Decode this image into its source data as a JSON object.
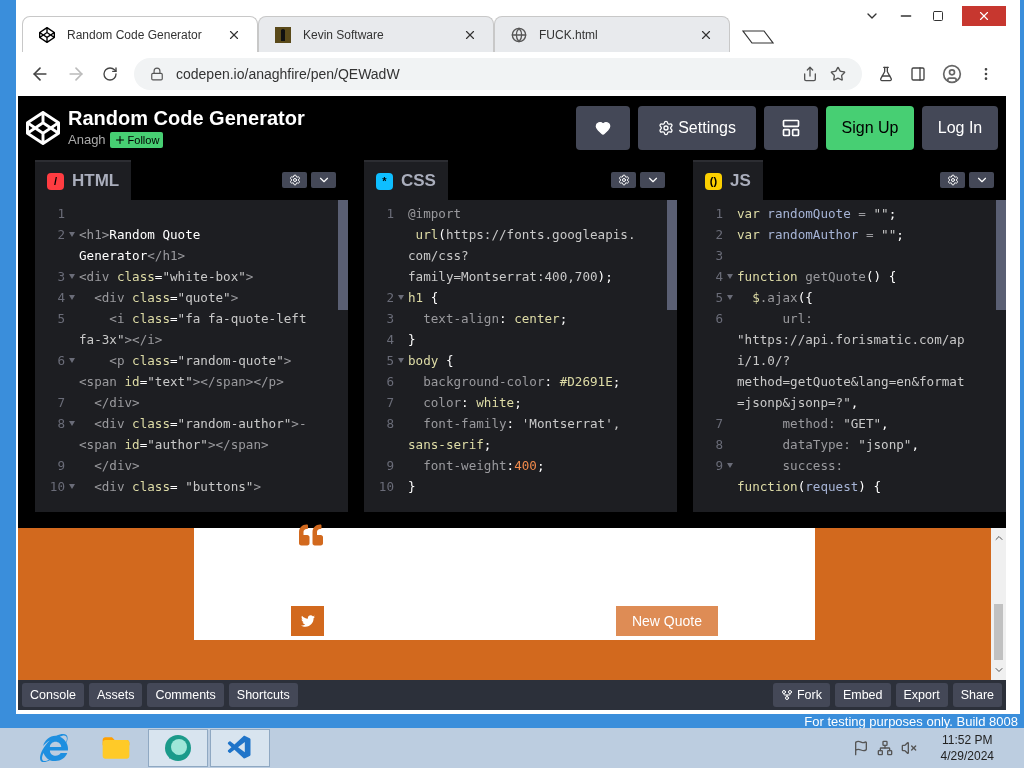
{
  "browser": {
    "tabs": [
      {
        "title": "Random Code Generator",
        "kind": "codepen",
        "selected": true
      },
      {
        "title": "Kevin Software",
        "kind": "thumbnail",
        "selected": false
      },
      {
        "title": "FUCK.html",
        "kind": "globe",
        "selected": false
      }
    ],
    "url": "codepen.io/anaghfire/pen/QEWadW",
    "forward_disabled": true
  },
  "header": {
    "title": "Random Code Generator",
    "author": "Anagh",
    "follow": "Follow",
    "settings": "Settings",
    "sign_up": "Sign Up",
    "log_in": "Log In"
  },
  "editors": [
    {
      "name": "HTML",
      "color": "#ff3c41",
      "symbol": "/",
      "lines": [
        {
          "number": "1",
          "fold": false
        },
        {
          "number": "2",
          "fold": true,
          "tokens": [
            {
              "kind": "tag",
              "text": "<h1>"
            },
            {
              "kind": "plain",
              "text": "Random Quote"
            }
          ]
        },
        {
          "fold": false,
          "tokens": [
            {
              "kind": "plain",
              "text": "Generator"
            },
            {
              "kind": "tag",
              "text": "</h1>"
            }
          ]
        },
        {
          "number": "3",
          "fold": true,
          "tokens": [
            {
              "kind": "tag",
              "text": "<div "
            },
            {
              "kind": "attr",
              "text": "class"
            },
            {
              "kind": "plain",
              "text": "="
            },
            {
              "kind": "str",
              "text": "\"white-box\""
            },
            {
              "kind": "tag",
              "text": ">"
            }
          ]
        },
        {
          "number": "4",
          "fold": true,
          "tokens": [
            {
              "kind": "tag",
              "text": "  <div "
            },
            {
              "kind": "attr",
              "text": "class"
            },
            {
              "kind": "plain",
              "text": "="
            },
            {
              "kind": "str",
              "text": "\"quote\""
            },
            {
              "kind": "tag",
              "text": ">"
            }
          ]
        },
        {
          "number": "5",
          "fold": false,
          "tokens": [
            {
              "kind": "tag",
              "text": "    <i "
            },
            {
              "kind": "attr",
              "text": "class"
            },
            {
              "kind": "plain",
              "text": "="
            },
            {
              "kind": "str",
              "text": "\"fa fa-quote-left"
            }
          ]
        },
        {
          "fold": false,
          "tokens": [
            {
              "kind": "str",
              "text": "fa-3x\""
            },
            {
              "kind": "tag",
              "text": "></i>"
            }
          ]
        },
        {
          "number": "6",
          "fold": true,
          "tokens": [
            {
              "kind": "tag",
              "text": "    <p "
            },
            {
              "kind": "attr",
              "text": "class"
            },
            {
              "kind": "plain",
              "text": "="
            },
            {
              "kind": "str",
              "text": "\"random-quote\""
            },
            {
              "kind": "tag",
              "text": ">"
            }
          ]
        },
        {
          "fold": false,
          "tokens": [
            {
              "kind": "tag",
              "text": "<span "
            },
            {
              "kind": "attr",
              "text": "id"
            },
            {
              "kind": "plain",
              "text": "="
            },
            {
              "kind": "str",
              "text": "\"text\""
            },
            {
              "kind": "tag",
              "text": "></span></p>"
            }
          ]
        },
        {
          "number": "7",
          "fold": false,
          "tokens": [
            {
              "kind": "tag",
              "text": "  </div>"
            }
          ]
        },
        {
          "number": "8",
          "fold": true,
          "tokens": [
            {
              "kind": "tag",
              "text": "  <div "
            },
            {
              "kind": "attr",
              "text": "class"
            },
            {
              "kind": "plain",
              "text": "="
            },
            {
              "kind": "str",
              "text": "\"random-author\""
            },
            {
              "kind": "tag",
              "text": ">-"
            }
          ]
        },
        {
          "fold": false,
          "tokens": [
            {
              "kind": "tag",
              "text": "<span "
            },
            {
              "kind": "attr",
              "text": "id"
            },
            {
              "kind": "plain",
              "text": "="
            },
            {
              "kind": "str",
              "text": "\"author\""
            },
            {
              "kind": "tag",
              "text": "></span>"
            }
          ]
        },
        {
          "number": "9",
          "fold": false,
          "tokens": [
            {
              "kind": "tag",
              "text": "  </div>"
            }
          ]
        },
        {
          "number": "10",
          "fold": true,
          "tokens": [
            {
              "kind": "tag",
              "text": "  <div "
            },
            {
              "kind": "attr",
              "text": "class"
            },
            {
              "kind": "plain",
              "text": "= "
            },
            {
              "kind": "str",
              "text": "\"buttons\""
            },
            {
              "kind": "tag",
              "text": ">"
            }
          ]
        }
      ]
    },
    {
      "name": "CSS",
      "color": "#0ebeff",
      "symbol": "*",
      "lines": [
        {
          "number": "1",
          "fold": false,
          "tokens": [
            {
              "kind": "tag",
              "text": "@import"
            }
          ]
        },
        {
          "fold": false,
          "tokens": [
            {
              "kind": "attr",
              "text": " url"
            },
            {
              "kind": "plain",
              "text": "("
            },
            {
              "kind": "str",
              "text": "https://fonts.googleapis."
            }
          ]
        },
        {
          "fold": false,
          "tokens": [
            {
              "kind": "str",
              "text": "com/css?"
            }
          ]
        },
        {
          "fold": false,
          "tokens": [
            {
              "kind": "str",
              "text": "family=Montserrat:400,700"
            },
            {
              "kind": "plain",
              "text": ");"
            }
          ]
        },
        {
          "number": "2",
          "fold": true,
          "tokens": [
            {
              "kind": "attr",
              "text": "h1"
            },
            {
              "kind": "plain",
              "text": " {"
            }
          ]
        },
        {
          "number": "3",
          "fold": false,
          "tokens": [
            {
              "kind": "tag",
              "text": "  text-align"
            },
            {
              "kind": "plain",
              "text": ": "
            },
            {
              "kind": "attr",
              "text": "center"
            },
            {
              "kind": "plain",
              "text": ";"
            }
          ]
        },
        {
          "number": "4",
          "fold": false,
          "tokens": [
            {
              "kind": "plain",
              "text": "}"
            }
          ]
        },
        {
          "number": "5",
          "fold": true,
          "tokens": [
            {
              "kind": "attr",
              "text": "body"
            },
            {
              "kind": "plain",
              "text": " {"
            }
          ]
        },
        {
          "number": "6",
          "fold": false,
          "tokens": [
            {
              "kind": "tag",
              "text": "  background-color"
            },
            {
              "kind": "plain",
              "text": ": "
            },
            {
              "kind": "attr",
              "text": "#D2691E"
            },
            {
              "kind": "plain",
              "text": ";"
            }
          ]
        },
        {
          "number": "7",
          "fold": false,
          "tokens": [
            {
              "kind": "tag",
              "text": "  color"
            },
            {
              "kind": "plain",
              "text": ": "
            },
            {
              "kind": "attr",
              "text": "white"
            },
            {
              "kind": "plain",
              "text": ";"
            }
          ]
        },
        {
          "number": "8",
          "fold": false,
          "tokens": [
            {
              "kind": "tag",
              "text": "  font-family"
            },
            {
              "kind": "plain",
              "text": ": "
            },
            {
              "kind": "str",
              "text": "'Montserrat',"
            }
          ]
        },
        {
          "fold": false,
          "tokens": [
            {
              "kind": "attr",
              "text": "sans-serif"
            },
            {
              "kind": "plain",
              "text": ";"
            }
          ]
        },
        {
          "number": "9",
          "fold": false,
          "tokens": [
            {
              "kind": "tag",
              "text": "  font-weight"
            },
            {
              "kind": "plain",
              "text": ":"
            },
            {
              "kind": "num",
              "text": "400"
            },
            {
              "kind": "plain",
              "text": ";"
            }
          ]
        },
        {
          "number": "10",
          "fold": false,
          "tokens": [
            {
              "kind": "plain",
              "text": "}"
            }
          ]
        }
      ]
    },
    {
      "name": "JS",
      "color": "#fcd000",
      "symbol": "()",
      "lines": [
        {
          "number": "1",
          "fold": false,
          "tokens": [
            {
              "kind": "attr",
              "text": "var"
            },
            {
              "kind": "var",
              "text": " randomQuote"
            },
            {
              "kind": "tag",
              "text": " = "
            },
            {
              "kind": "str",
              "text": "\"\""
            },
            {
              "kind": "plain",
              "text": ";"
            }
          ]
        },
        {
          "number": "2",
          "fold": false,
          "tokens": [
            {
              "kind": "attr",
              "text": "var"
            },
            {
              "kind": "var",
              "text": " randomAuthor"
            },
            {
              "kind": "tag",
              "text": " = "
            },
            {
              "kind": "str",
              "text": "\"\""
            },
            {
              "kind": "plain",
              "text": ";"
            }
          ]
        },
        {
          "number": "3",
          "fold": false
        },
        {
          "number": "4",
          "fold": true,
          "tokens": [
            {
              "kind": "attr",
              "text": "function"
            },
            {
              "kind": "tag",
              "text": " getQuote"
            },
            {
              "kind": "plain",
              "text": "() {"
            }
          ]
        },
        {
          "number": "5",
          "fold": true,
          "tokens": [
            {
              "kind": "attr",
              "text": "  $"
            },
            {
              "kind": "tag",
              "text": ".ajax"
            },
            {
              "kind": "plain",
              "text": "({"
            }
          ]
        },
        {
          "number": "6",
          "fold": false,
          "tokens": [
            {
              "kind": "tag",
              "text": "      url:"
            }
          ]
        },
        {
          "fold": false,
          "tokens": [
            {
              "kind": "str",
              "text": "\"https://api.forismatic.com/ap"
            }
          ]
        },
        {
          "fold": false,
          "tokens": [
            {
              "kind": "str",
              "text": "i/1.0/?"
            }
          ]
        },
        {
          "fold": false,
          "tokens": [
            {
              "kind": "str",
              "text": "method=getQuote&lang=en&format"
            }
          ]
        },
        {
          "fold": false,
          "tokens": [
            {
              "kind": "str",
              "text": "=jsonp&jsonp=?\""
            },
            {
              "kind": "plain",
              "text": ","
            }
          ]
        },
        {
          "number": "7",
          "fold": false,
          "tokens": [
            {
              "kind": "tag",
              "text": "      method: "
            },
            {
              "kind": "str",
              "text": "\"GET\""
            },
            {
              "kind": "plain",
              "text": ","
            }
          ]
        },
        {
          "number": "8",
          "fold": false,
          "tokens": [
            {
              "kind": "tag",
              "text": "      dataType: "
            },
            {
              "kind": "str",
              "text": "\"jsonp\""
            },
            {
              "kind": "plain",
              "text": ","
            }
          ]
        },
        {
          "number": "9",
          "fold": true,
          "tokens": [
            {
              "kind": "tag",
              "text": "      success:"
            }
          ]
        },
        {
          "fold": false,
          "tokens": [
            {
              "kind": "attr",
              "text": "function"
            },
            {
              "kind": "plain",
              "text": "("
            },
            {
              "kind": "var",
              "text": "request"
            },
            {
              "kind": "plain",
              "text": ") {"
            }
          ]
        }
      ]
    }
  ],
  "preview": {
    "new_quote": "New Quote"
  },
  "bottom_bar": {
    "left": [
      "Console",
      "Assets",
      "Comments",
      "Shortcuts"
    ],
    "right": [
      {
        "label": "Fork",
        "kind": "fork"
      },
      {
        "label": "Embed",
        "kind": "plain"
      },
      {
        "label": "Export",
        "kind": "plain"
      },
      {
        "label": "Share",
        "kind": "plain"
      }
    ]
  },
  "desktop": {
    "notice": "For testing purposes only. Build 8008"
  },
  "taskbar": {
    "apps": [
      {
        "kind": "ie",
        "running": false
      },
      {
        "kind": "folder",
        "running": false
      },
      {
        "kind": "chat",
        "running": true
      },
      {
        "kind": "vscode",
        "running": true
      }
    ],
    "time": "11:52 PM",
    "date": "4/29/2024"
  }
}
